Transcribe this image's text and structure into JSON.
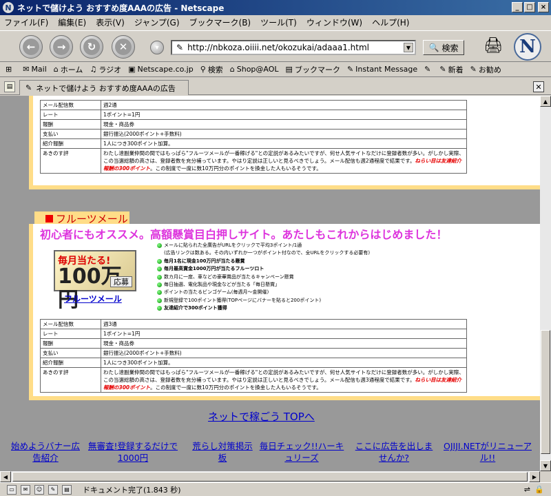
{
  "window": {
    "title": "ネットで儲けよう おすすめ度AAAの広告 - Netscape",
    "minimize": "_",
    "maximize": "□",
    "close": "×"
  },
  "menu": [
    "ファイル(F)",
    "編集(E)",
    "表示(V)",
    "ジャンプ(G)",
    "ブックマーク(B)",
    "ツール(T)",
    "ウィンドウ(W)",
    "ヘルプ(H)"
  ],
  "toolbar": {
    "url": "http://nbkoza.oiiii.net/okozukai/adaaa1.html",
    "search_label": "検索",
    "throbber": "N"
  },
  "personal_toolbar": [
    "Mail",
    "ホーム",
    "ラジオ",
    "Netscape.co.jp",
    "検索",
    "Shop@AOL",
    "ブックマーク",
    "Instant Message",
    "新着",
    "お勧め"
  ],
  "tab": {
    "title": "ネットで儲けよう おすすめ度AAAの広告"
  },
  "section1": {
    "rows": [
      {
        "k": "メール配信数",
        "v": "週2通"
      },
      {
        "k": "レート",
        "v": "1ポイント=1円"
      },
      {
        "k": "報酬",
        "v": "現金・商品券"
      },
      {
        "k": "支払い",
        "v": "銀行振込(2000ポイント+手数料)"
      },
      {
        "k": "紹介報酬",
        "v": "1人につき300ポイント加算。"
      }
    ],
    "comment_label": "あきのす評",
    "comment": "わたし達副業仲間の間ではもっぱら\"フルーツメールが一番稼げる\"との定説があるみたいですが、何せ人気サイトなだけに登録者数が多い。がしかし実際、この当選総額の高さは、登録者数を充分補っています。やはり定説は正しいと見るべきでしょう。メール配信も週2通程度で結果です。",
    "comment_hl": "ねらい目は友達紹介報酬の300ポイント",
    "comment_tail": "。この制度で一度に数10万円分のポイントを換金した人もいるそうです。"
  },
  "section2": {
    "header": "フルーツメール",
    "headline": "初心者にもオススメ。高額懸賞目白押しサイト。あたしもこれからはじめました！",
    "banner": {
      "line1": "毎月当たる!",
      "line2": "100万円",
      "button": "応募"
    },
    "banner_link": "フルーツメール",
    "bullets": [
      {
        "text": "メールに貼られた全廣告がURLをクリックで平均3ポイント/1通",
        "bold": false
      },
      {
        "text": "(広告リンクは数ある。その内いずれか一つがポイント付なので、全URLをクリックする必要有)",
        "bold": false
      },
      {
        "text": "毎月1名に現金100万円が当たる懸賞",
        "bold": true
      },
      {
        "text": "毎月最高賞金1000万円が当たるフルーツロト",
        "bold": true
      },
      {
        "text": "数カ月に一度、車などの豪華賞品が当たるキャンペーン懸賞",
        "bold": false
      },
      {
        "text": "毎日抽選、電化製品や現金などが当たる「毎日懸賞」",
        "bold": false
      },
      {
        "text": "ポイントの当たるビンゴゲーム(毎週月～金開催)",
        "bold": false
      },
      {
        "text": "新規登録で100ポイント獲得(TOPページにバナーを貼ると200ポイント)",
        "bold": false
      },
      {
        "text": "友達紹介で300ポイント獲得",
        "bold": true
      }
    ],
    "rows": [
      {
        "k": "メール配信数",
        "v": "週3通"
      },
      {
        "k": "レート",
        "v": "1ポイント=1円"
      },
      {
        "k": "報酬",
        "v": "現金・商品券"
      },
      {
        "k": "支払い",
        "v": "銀行振込(2000ポイント+手数料)"
      },
      {
        "k": "紹介報酬",
        "v": "1人につき300ポイント加算。"
      }
    ],
    "comment_label": "あきのす評",
    "comment": "わたし達副業仲間の間ではもっぱら\"フルーツメールが一番稼げる\"との定説があるみたいですが、何せ人気サイトなだけに登録者数が多い。がしかし実際、この当選総額の高さは、登録者数を充分補っています。やはり定説は正しいと見るべきでしょう。メール配信も週3通程度で結果です。",
    "comment_hl": "ねらい目は友達紹介報酬の300ポイント",
    "comment_tail": "。この制度で一度に数10万円分のポイントを換金した人もいるそうです。"
  },
  "top_link": "ネットで稼ごう TOPへ",
  "footer_links": [
    "始めようバナー広告紹介",
    "無審査!登録するだけで1000円",
    "荒らし対策掲示板",
    "毎日チェック!!ハーキュリーズ",
    "ここに広告を出しませんか?",
    "OJIJI.NETがリニューアル!!"
  ],
  "status": {
    "text": "ドキュメント完了(1.843 秒)"
  }
}
